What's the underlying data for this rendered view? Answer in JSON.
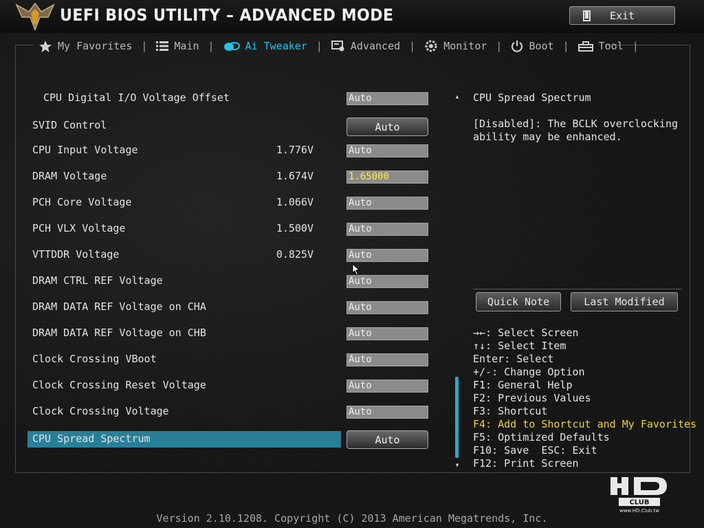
{
  "header": {
    "title": "UEFI BIOS UTILITY – ADVANCED MODE",
    "exit_label": "Exit"
  },
  "tabs": [
    {
      "label": "My Favorites",
      "icon": "star-icon"
    },
    {
      "label": "Main",
      "icon": "list-icon"
    },
    {
      "label": "Ai Tweaker",
      "icon": "ai-tweaker-icon",
      "active": true
    },
    {
      "label": "Advanced",
      "icon": "advanced-icon"
    },
    {
      "label": "Monitor",
      "icon": "monitor-icon"
    },
    {
      "label": "Boot",
      "icon": "power-icon"
    },
    {
      "label": "Tool",
      "icon": "tool-icon"
    }
  ],
  "settings": [
    {
      "label": "CPU Digital I/O Voltage Offset",
      "reading": "",
      "value": "Auto"
    },
    {
      "label": "SVID Control",
      "reading": "",
      "value": "Auto"
    },
    {
      "label": "CPU Input Voltage",
      "reading": "1.776V",
      "value": "Auto"
    },
    {
      "label": "DRAM Voltage",
      "reading": "1.674V",
      "value": "1.65000"
    },
    {
      "label": "PCH Core Voltage",
      "reading": "1.066V",
      "value": "Auto"
    },
    {
      "label": "PCH VLX Voltage",
      "reading": "1.500V",
      "value": "Auto"
    },
    {
      "label": "VTTDDR Voltage",
      "reading": "0.825V",
      "value": "Auto"
    },
    {
      "label": "DRAM CTRL REF Voltage",
      "reading": "",
      "value": "Auto"
    },
    {
      "label": "DRAM DATA REF Voltage on CHA",
      "reading": "",
      "value": "Auto"
    },
    {
      "label": "DRAM DATA REF Voltage on CHB",
      "reading": "",
      "value": "Auto"
    },
    {
      "label": "Clock Crossing VBoot",
      "reading": "",
      "value": "Auto"
    },
    {
      "label": "Clock Crossing Reset Voltage",
      "reading": "",
      "value": "Auto"
    },
    {
      "label": "Clock Crossing Voltage",
      "reading": "",
      "value": "Auto"
    },
    {
      "label": "CPU Spread Spectrum",
      "reading": "",
      "value": "Auto"
    }
  ],
  "help": {
    "title": "CPU Spread Spectrum",
    "text": "[Disabled]: The BCLK overclocking ability may be enhanced.",
    "quick_note": "Quick Note",
    "last_modified": "Last Modified"
  },
  "keys": [
    "→←: Select Screen",
    "↑↓: Select Item",
    "Enter: Select",
    "+/-: Change Option",
    "F1: General Help",
    "F2: Previous Values",
    "F3: Shortcut",
    "F4: Add to Shortcut and My Favorites",
    "F5: Optimized Defaults",
    "F10: Save  ESC: Exit",
    "F12: Print Screen"
  ],
  "watermark": {
    "text": "www.HD.Club.tw"
  },
  "footer": "Version 2.10.1208. Copyright (C) 2013 American Megatrends, Inc.",
  "colors": {
    "accent": "#25c3e8",
    "highlight": "#2a7f98",
    "shortcut_key": "#e9d43f",
    "edited_value": "#ffef4a"
  }
}
